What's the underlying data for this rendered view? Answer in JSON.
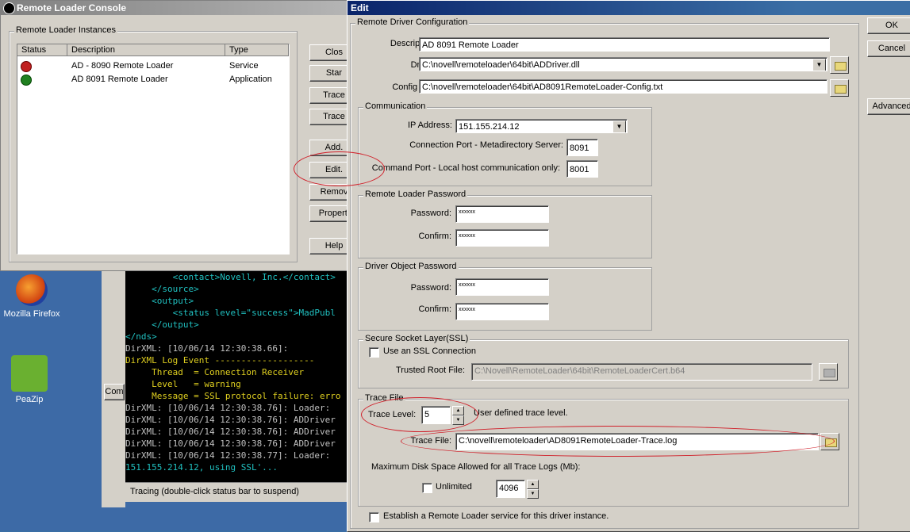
{
  "desktop": {
    "icons": [
      {
        "label": "Mozilla Firefox",
        "icon": "firefox-icon"
      },
      {
        "label": "PeaZip",
        "icon": "peazip-icon"
      }
    ]
  },
  "console": {
    "title": "Remote Loader Console",
    "instances_group": "Remote Loader Instances",
    "columns": [
      "Status",
      "Description",
      "Type"
    ],
    "rows": [
      {
        "status": "stopped",
        "description": "AD - 8090 Remote Loader",
        "type": "Service"
      },
      {
        "status": "running",
        "description": "AD 8091 Remote Loader",
        "type": "Application"
      }
    ],
    "buttons": [
      "Clos",
      "Star",
      "Trace",
      "Trace",
      "Add.",
      "Edit.",
      "Remov",
      "Properti",
      "Help"
    ]
  },
  "terminal": {
    "lines": [
      {
        "text": "         <contact>Novell, Inc.</contact>",
        "color": "cyan"
      },
      {
        "text": "     </source>",
        "color": "cyan"
      },
      {
        "text": "     <output>",
        "color": "cyan"
      },
      {
        "text": "         <status level=\"success\">MadPubl",
        "color": "cyan"
      },
      {
        "text": "     </output>",
        "color": "cyan"
      },
      {
        "text": "</nds>",
        "color": "cyan"
      },
      {
        "text": "DirXML: [10/06/14 12:30:38.66]:",
        "color": "white"
      },
      {
        "text": "DirXML Log Event -------------------",
        "color": "yellow"
      },
      {
        "text": "     Thread  = Connection Receiver",
        "color": "yellow"
      },
      {
        "text": "     Level   = warning",
        "color": "yellow"
      },
      {
        "text": "     Message = SSL protocol failure: erro",
        "color": "yellow"
      },
      {
        "text": "DirXML: [10/06/14 12:30:38.76]: Loader:",
        "color": "white"
      },
      {
        "text": "DirXML: [10/06/14 12:30:38.76]: ADDriver",
        "color": "white"
      },
      {
        "text": "DirXML: [10/06/14 12:30:38.76]: ADDriver",
        "color": "white"
      },
      {
        "text": "DirXML: [10/06/14 12:30:38.76]: ADDriver",
        "color": "white"
      },
      {
        "text": "DirXML: [10/06/14 12:30:38.77]: Loader:",
        "color": "white"
      },
      {
        "text": "151.155.214.12, using SSL'...",
        "color": "cyan"
      }
    ],
    "status_bar": "Tracing (double-click status bar to suspend)",
    "side_button": "Com"
  },
  "edit": {
    "title": "Edit",
    "buttons": {
      "ok": "OK",
      "cancel": "Cancel",
      "advanced": "Advanced"
    },
    "driver_config": {
      "group": "Remote Driver Configuration",
      "description_label": "Description:",
      "description_value": "AD 8091 Remote Loader",
      "driver_label": "Driver:",
      "driver_value": "C:\\novell\\remoteloader\\64bit\\ADDriver.dll",
      "config_label": "Config File:",
      "config_value": "C:\\novell\\remoteloader\\64bit\\AD8091RemoteLoader-Config.txt"
    },
    "communication": {
      "group": "Communication",
      "ip_label": "IP Address:",
      "ip_value": "151.155.214.12",
      "conn_port_label": "Connection Port - Metadirectory Server:",
      "conn_port_value": "8091",
      "cmd_port_label": "Command Port - Local host communication only:",
      "cmd_port_value": "8001"
    },
    "rl_password": {
      "group": "Remote Loader Password",
      "password_label": "Password:",
      "password_value": "xxxxxx",
      "confirm_label": "Confirm:",
      "confirm_value": "xxxxxx"
    },
    "driver_password": {
      "group": "Driver Object Password",
      "password_label": "Password:",
      "password_value": "xxxxxx",
      "confirm_label": "Confirm:",
      "confirm_value": "xxxxxx"
    },
    "ssl": {
      "group": "Secure Socket Layer(SSL)",
      "use_ssl_label": "Use an SSL Connection",
      "trusted_root_label": "Trusted Root File:",
      "trusted_root_value": "C:\\Novell\\RemoteLoader\\64bit\\RemoteLoaderCert.b64"
    },
    "trace": {
      "group": "Trace File",
      "level_label": "Trace Level:",
      "level_value": "5",
      "level_desc": "User defined trace level.",
      "file_label": "Trace File:",
      "file_value": "C:\\novell\\remoteloader\\AD8091RemoteLoader-Trace.log",
      "max_disk_label": "Maximum Disk Space Allowed for all Trace Logs (Mb):",
      "unlimited_label": "Unlimited",
      "max_disk_value": "4096"
    },
    "service_label": "Establish a Remote Loader service for this driver instance."
  },
  "colors": {
    "annotation": "#d0202a",
    "titlebar_active": "#0a246a"
  }
}
